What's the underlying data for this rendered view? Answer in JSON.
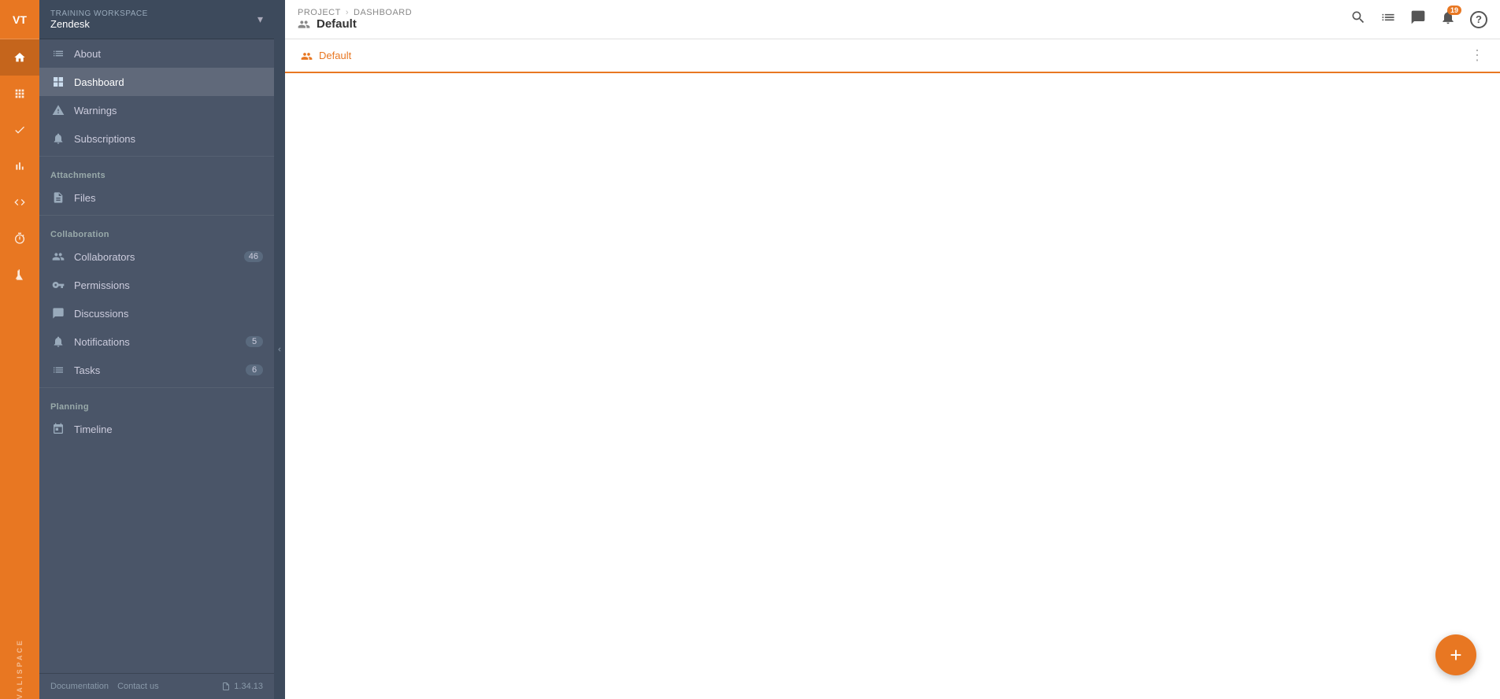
{
  "workspace": {
    "label": "TRAINING WORKSPACE",
    "name": "Zendesk"
  },
  "avatar": {
    "initials": "VT"
  },
  "rail": {
    "icons": [
      {
        "name": "home-icon",
        "symbol": "⌂",
        "active": true
      },
      {
        "name": "modules-icon",
        "symbol": "⊞",
        "active": false
      },
      {
        "name": "tasks-icon",
        "symbol": "✓",
        "active": false
      },
      {
        "name": "analytics-icon",
        "symbol": "📊",
        "active": false
      },
      {
        "name": "code-icon",
        "symbol": "</>",
        "active": false
      },
      {
        "name": "timer-icon",
        "symbol": "⏱",
        "active": false
      },
      {
        "name": "lab-icon",
        "symbol": "🧪",
        "active": false
      }
    ],
    "brand": "VALISPACE"
  },
  "sidebar": {
    "sections": [
      {
        "label": "",
        "items": [
          {
            "id": "about",
            "label": "About",
            "icon": "≡",
            "active": false,
            "badge": null
          },
          {
            "id": "dashboard",
            "label": "Dashboard",
            "icon": "▦",
            "active": true,
            "badge": null
          },
          {
            "id": "warnings",
            "label": "Warnings",
            "icon": "⚠",
            "active": false,
            "badge": null
          },
          {
            "id": "subscriptions",
            "label": "Subscriptions",
            "icon": "🔔",
            "active": false,
            "badge": null
          }
        ]
      },
      {
        "label": "Attachments",
        "items": [
          {
            "id": "files",
            "label": "Files",
            "icon": "📄",
            "active": false,
            "badge": null
          }
        ]
      },
      {
        "label": "Collaboration",
        "items": [
          {
            "id": "collaborators",
            "label": "Collaborators",
            "icon": "👥",
            "active": false,
            "badge": "46"
          },
          {
            "id": "permissions",
            "label": "Permissions",
            "icon": "🔑",
            "active": false,
            "badge": null
          },
          {
            "id": "discussions",
            "label": "Discussions",
            "icon": "💬",
            "active": false,
            "badge": null
          },
          {
            "id": "notifications",
            "label": "Notifications",
            "icon": "🔔",
            "active": false,
            "badge": "5"
          },
          {
            "id": "tasks",
            "label": "Tasks",
            "icon": "≡",
            "active": false,
            "badge": "6"
          }
        ]
      },
      {
        "label": "Planning",
        "items": [
          {
            "id": "timeline",
            "label": "Timeline",
            "icon": "📅",
            "active": false,
            "badge": null
          }
        ]
      }
    ],
    "footer": {
      "documentation": "Documentation",
      "contact": "Contact us",
      "version": "1.34.13"
    }
  },
  "topbar": {
    "breadcrumb": {
      "project": "PROJECT",
      "separator": "›",
      "page": "DASHBOARD"
    },
    "title": "Default",
    "icons": {
      "search": "🔍",
      "list": "☰",
      "chat": "💬",
      "bell": "🔔",
      "notif_count": "19",
      "help": "?"
    }
  },
  "tabs": [
    {
      "id": "default",
      "label": "Default",
      "active": true
    }
  ],
  "fab": {
    "symbol": "+"
  }
}
